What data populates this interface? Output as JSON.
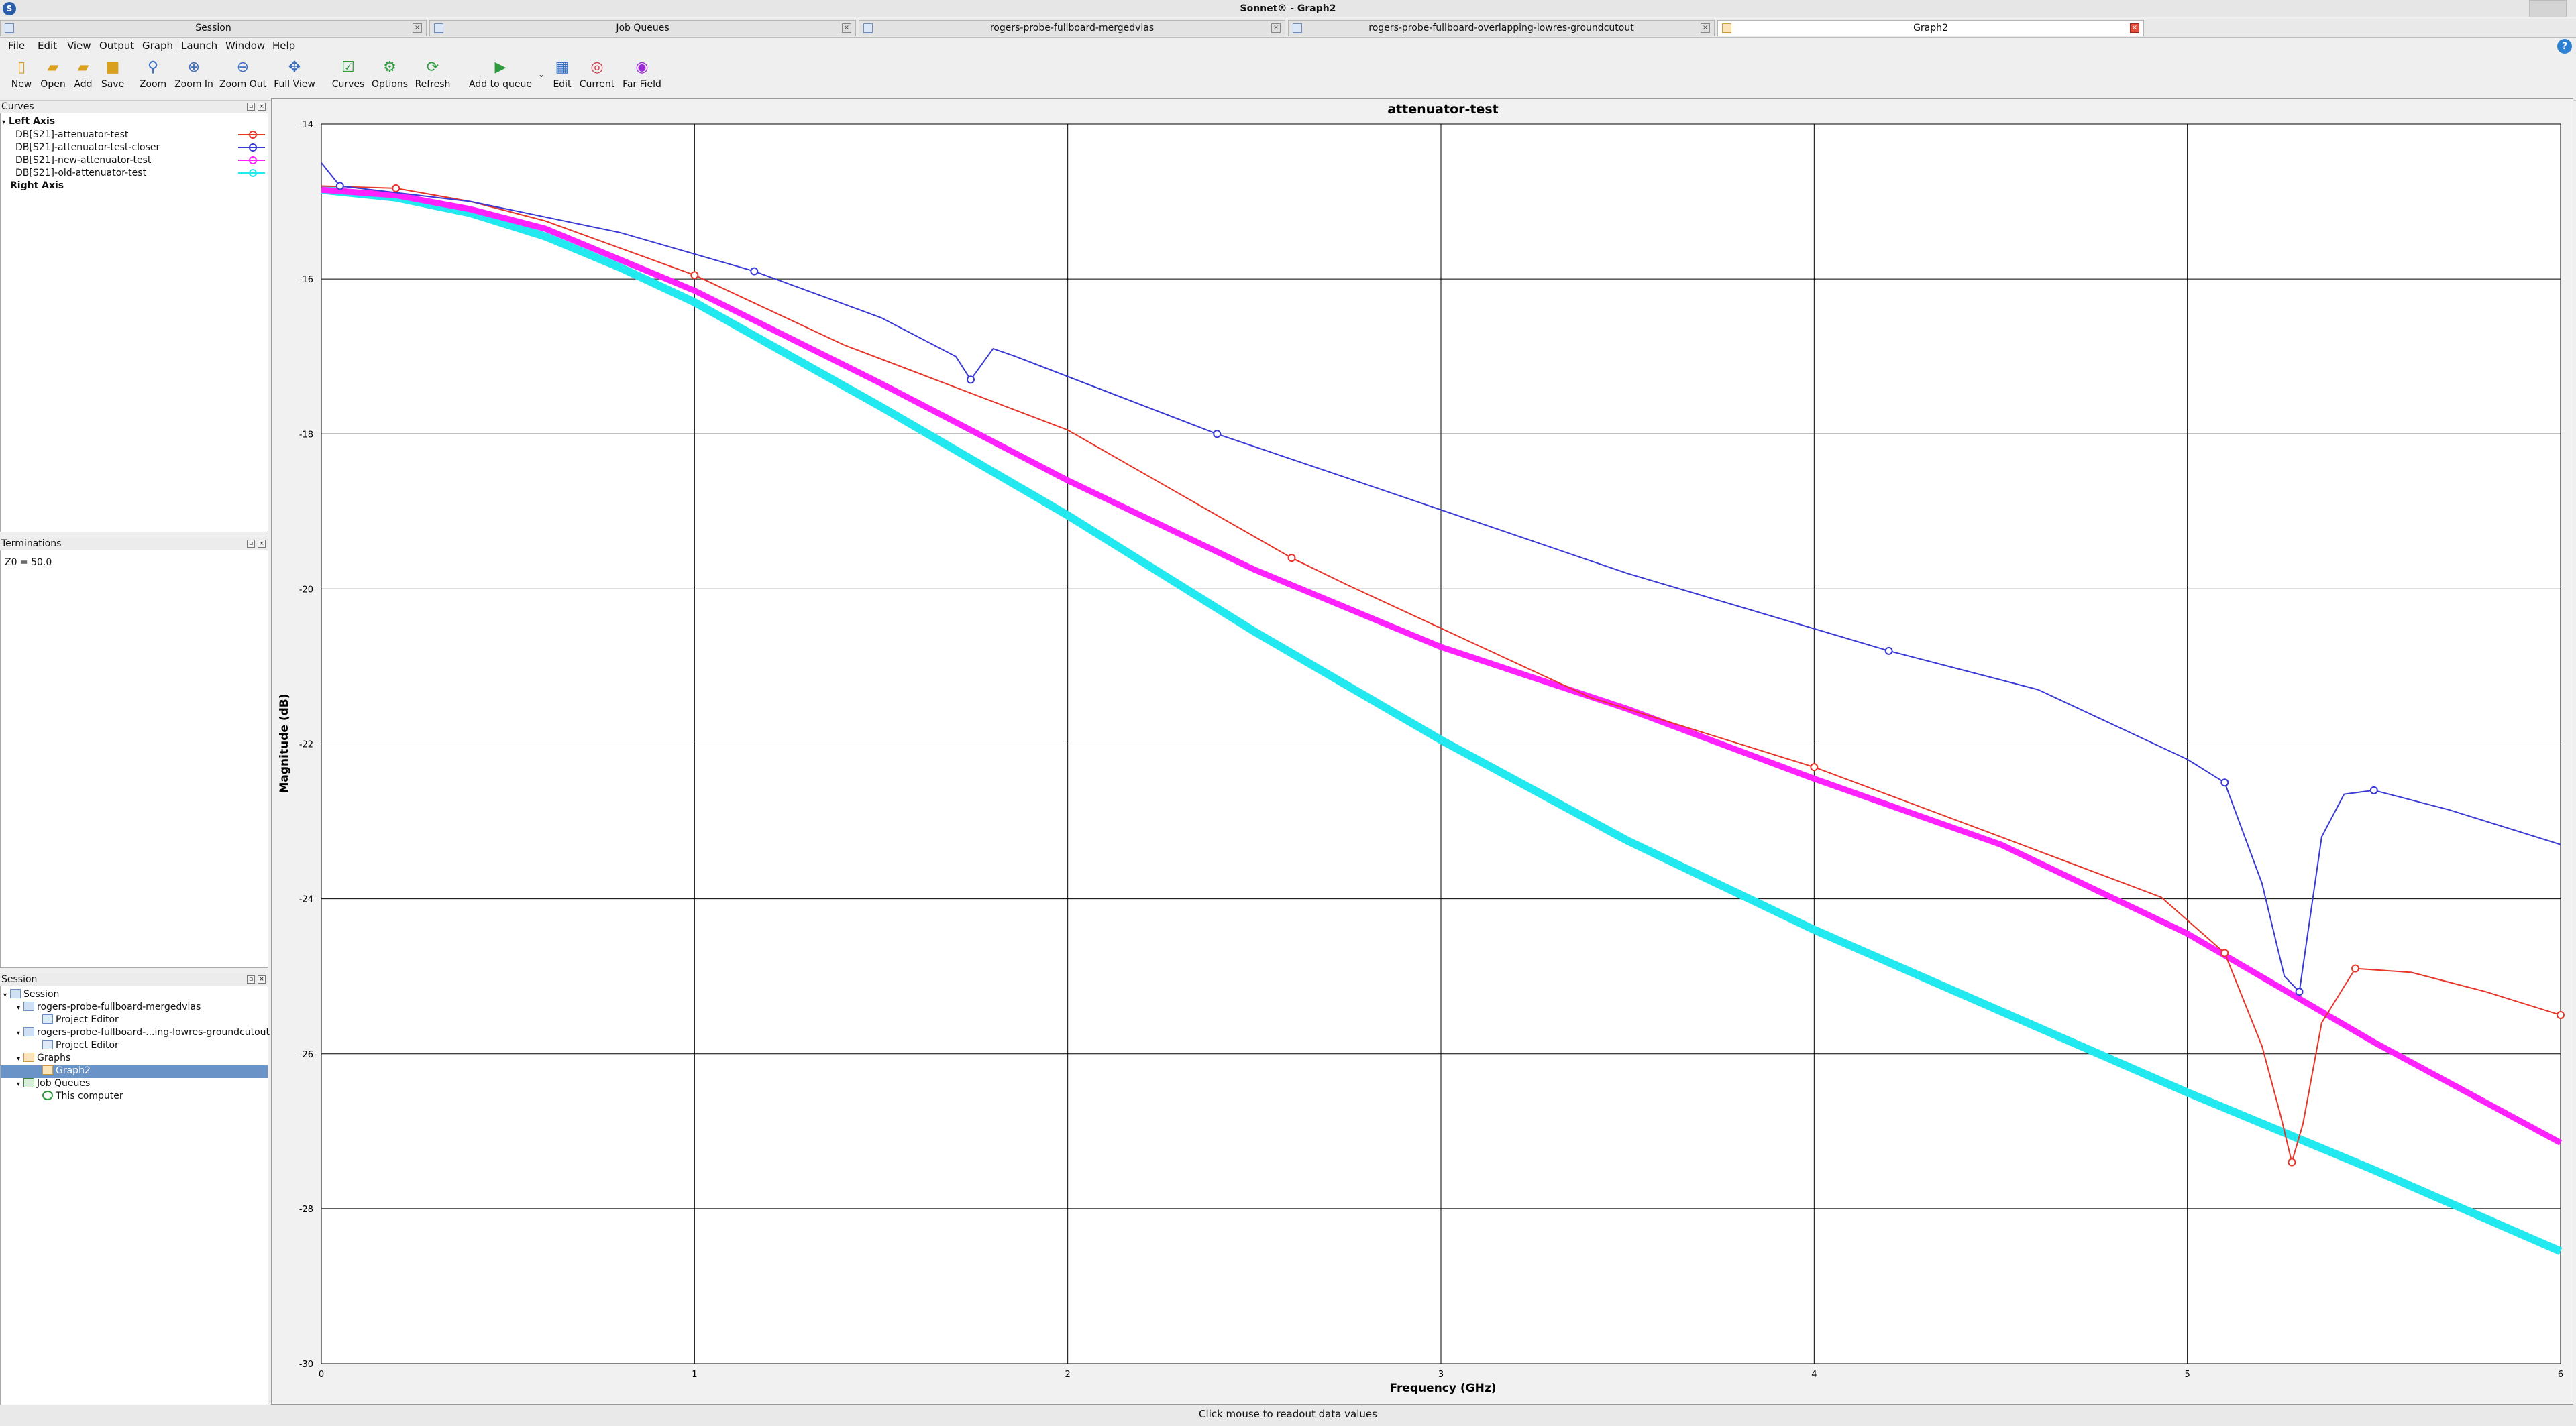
{
  "window": {
    "title": "Sonnet® - Graph2"
  },
  "tabs": [
    {
      "label": "Session",
      "active": false
    },
    {
      "label": "Job Queues",
      "active": false
    },
    {
      "label": "rogers-probe-fullboard-mergedvias",
      "active": false
    },
    {
      "label": "rogers-probe-fullboard-overlapping-lowres-groundcutout",
      "active": false
    },
    {
      "label": "Graph2",
      "active": true
    }
  ],
  "menu": [
    "File",
    "Edit",
    "View",
    "Output",
    "Graph",
    "Launch",
    "Window",
    "Help"
  ],
  "toolbar": [
    {
      "label": "New",
      "icon": "new-file-icon"
    },
    {
      "label": "Open",
      "icon": "open-folder-icon"
    },
    {
      "label": "Add",
      "icon": "add-folder-icon"
    },
    {
      "label": "Save",
      "icon": "save-icon"
    },
    {
      "label": "Zoom",
      "icon": "zoom-icon"
    },
    {
      "label": "Zoom In",
      "icon": "zoom-in-icon"
    },
    {
      "label": "Zoom Out",
      "icon": "zoom-out-icon"
    },
    {
      "label": "Full View",
      "icon": "full-view-icon"
    },
    {
      "label": "Curves",
      "icon": "curves-icon"
    },
    {
      "label": "Options",
      "icon": "options-icon"
    },
    {
      "label": "Refresh",
      "icon": "refresh-icon"
    },
    {
      "label": "Add to queue",
      "icon": "add-to-queue-icon"
    },
    {
      "label": "Edit",
      "icon": "edit-icon"
    },
    {
      "label": "Current",
      "icon": "current-icon"
    },
    {
      "label": "Far Field",
      "icon": "far-field-icon"
    }
  ],
  "curves_panel": {
    "title": "Curves",
    "left_axis": "Left Axis",
    "right_axis": "Right Axis",
    "items": [
      {
        "label": "DB[S21]-attenuator-test",
        "color": "#e8362a"
      },
      {
        "label": "DB[S21]-attenuator-test-closer",
        "color": "#3a3ad6"
      },
      {
        "label": "DB[S21]-new-attenuator-test",
        "color": "#ff22ff"
      },
      {
        "label": "DB[S21]-old-attenuator-test",
        "color": "#22e8f0"
      }
    ]
  },
  "terminations_panel": {
    "title": "Terminations",
    "text": "Z0 = 50.0"
  },
  "session_panel": {
    "title": "Session",
    "tree": [
      {
        "label": "Session",
        "level": 0
      },
      {
        "label": "rogers-probe-fullboard-mergedvias",
        "level": 1
      },
      {
        "label": "Project Editor",
        "level": 2
      },
      {
        "label": "rogers-probe-fullboard-...ing-lowres-groundcutout",
        "level": 1
      },
      {
        "label": "Project Editor",
        "level": 2
      },
      {
        "label": "Graphs",
        "level": 1
      },
      {
        "label": "Graph2",
        "level": 2,
        "selected": true
      },
      {
        "label": "Job Queues",
        "level": 1
      },
      {
        "label": "This computer",
        "level": 2
      }
    ]
  },
  "status": "Click mouse to readout data values",
  "chart_data": {
    "type": "line",
    "title": "attenuator-test",
    "xlabel": "Frequency (GHz)",
    "ylabel": "Magnitude (dB)",
    "xlim": [
      0,
      6
    ],
    "ylim": [
      -30,
      -14
    ],
    "xticks": [
      0,
      1,
      2,
      3,
      4,
      5,
      6
    ],
    "yticks": [
      -14,
      -16,
      -18,
      -20,
      -22,
      -24,
      -26,
      -28,
      -30
    ],
    "grid": true,
    "series": [
      {
        "name": "DB[S21]-attenuator-test",
        "color": "#e8362a",
        "x": [
          0,
          0.2,
          0.4,
          0.6,
          1.0,
          1.4,
          2.0,
          2.6,
          2.75,
          3.4,
          4.0,
          4.5,
          4.93,
          5.1,
          5.2,
          5.25,
          5.28,
          5.31,
          5.36,
          5.45,
          5.6,
          5.8,
          6.0
        ],
        "y": [
          -14.8,
          -14.83,
          -15.0,
          -15.25,
          -15.95,
          -16.85,
          -17.95,
          -19.6,
          -19.95,
          -21.4,
          -22.3,
          -23.2,
          -23.98,
          -24.7,
          -25.9,
          -26.8,
          -27.4,
          -26.9,
          -25.6,
          -24.9,
          -24.95,
          -25.2,
          -25.5
        ]
      },
      {
        "name": "DB[S21]-attenuator-test-closer",
        "color": "#3a3ad6",
        "x": [
          0,
          0.05,
          0.4,
          0.8,
          1.16,
          1.5,
          1.7,
          1.74,
          1.8,
          1.86,
          2.4,
          2.86,
          3.5,
          4.2,
          4.6,
          5.0,
          5.1,
          5.2,
          5.26,
          5.3,
          5.36,
          5.42,
          5.5,
          5.7,
          6.0
        ],
        "y": [
          -14.5,
          -14.8,
          -15.0,
          -15.4,
          -15.9,
          -16.5,
          -17.0,
          -17.3,
          -16.9,
          -17.0,
          -18.0,
          -18.75,
          -19.8,
          -20.8,
          -21.3,
          -22.2,
          -22.5,
          -23.8,
          -25.0,
          -25.2,
          -23.2,
          -22.65,
          -22.6,
          -22.85,
          -23.3
        ]
      },
      {
        "name": "DB[S21]-new-attenuator-test",
        "color": "#ff22ff",
        "x": [
          0,
          0.2,
          0.4,
          0.6,
          0.8,
          1.0,
          1.5,
          2.0,
          2.5,
          3.0,
          3.5,
          4.0,
          4.5,
          5.0,
          5.5,
          6.0
        ],
        "y": [
          -14.85,
          -14.92,
          -15.1,
          -15.35,
          -15.75,
          -16.15,
          -17.35,
          -18.6,
          -19.75,
          -20.75,
          -21.55,
          -22.45,
          -23.3,
          -24.45,
          -25.85,
          -27.15
        ]
      },
      {
        "name": "DB[S21]-old-attenuator-test",
        "color": "#22e8f0",
        "x": [
          0,
          0.2,
          0.4,
          0.6,
          0.8,
          1.0,
          1.5,
          2.0,
          2.5,
          3.0,
          3.5,
          4.0,
          4.5,
          5.0,
          5.5,
          6.0
        ],
        "y": [
          -14.85,
          -14.95,
          -15.15,
          -15.45,
          -15.85,
          -16.3,
          -17.65,
          -19.05,
          -20.55,
          -21.95,
          -23.25,
          -24.4,
          -25.45,
          -26.5,
          -27.5,
          -28.55
        ]
      }
    ]
  }
}
